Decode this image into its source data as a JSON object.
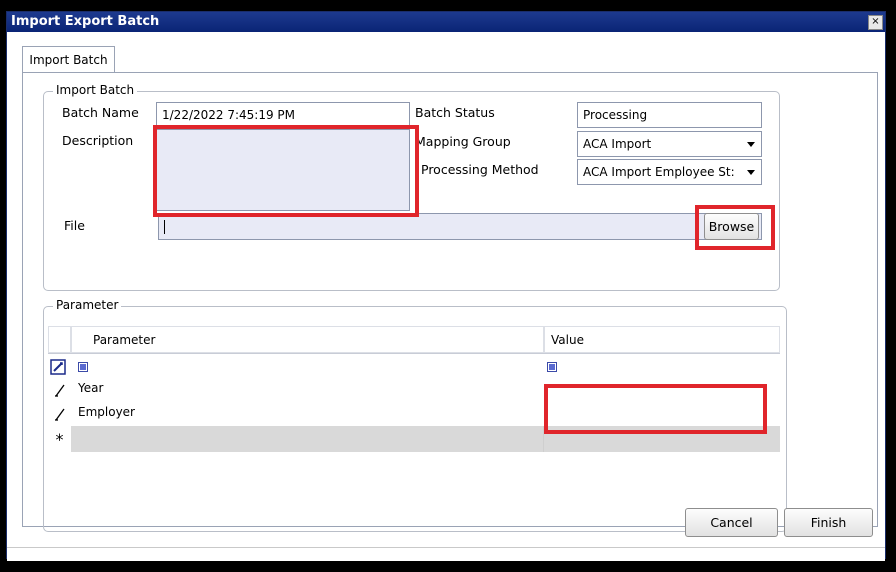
{
  "window": {
    "title": "Import Export Batch",
    "close_glyph": "×"
  },
  "tabs": [
    {
      "label": "Import Batch"
    }
  ],
  "import_batch": {
    "legend": "Import Batch",
    "batch_name_label": "Batch Name",
    "batch_name_value": "1/22/2022 7:45:19 PM",
    "description_label": "Description",
    "description_value": "",
    "batch_status_label": "Batch Status",
    "batch_status_value": "Processing",
    "mapping_group_label": "Mapping Group",
    "mapping_group_value": "ACA Import",
    "processing_method_label": "Processing Method",
    "processing_method_value": "ACA Import Employee St:",
    "file_label": "File",
    "file_value": "",
    "browse_label": "Browse"
  },
  "parameter": {
    "legend": "Parameter",
    "columns": [
      "Parameter",
      "Value"
    ],
    "rows": [
      {
        "indicator_icon": "edit-row-icon",
        "name": "",
        "value": ""
      },
      {
        "indicator_icon": "pencil-icon",
        "name": "Year",
        "value": ""
      },
      {
        "indicator_icon": "pencil-icon",
        "name": "Employer",
        "value": ""
      },
      {
        "indicator_icon": "new-row-asterisk-icon",
        "name": "",
        "value": ""
      }
    ],
    "new_row_glyph": "*"
  },
  "footer": {
    "cancel_label": "Cancel",
    "finish_label": "Finish"
  },
  "annotation_color": "#e0252b"
}
